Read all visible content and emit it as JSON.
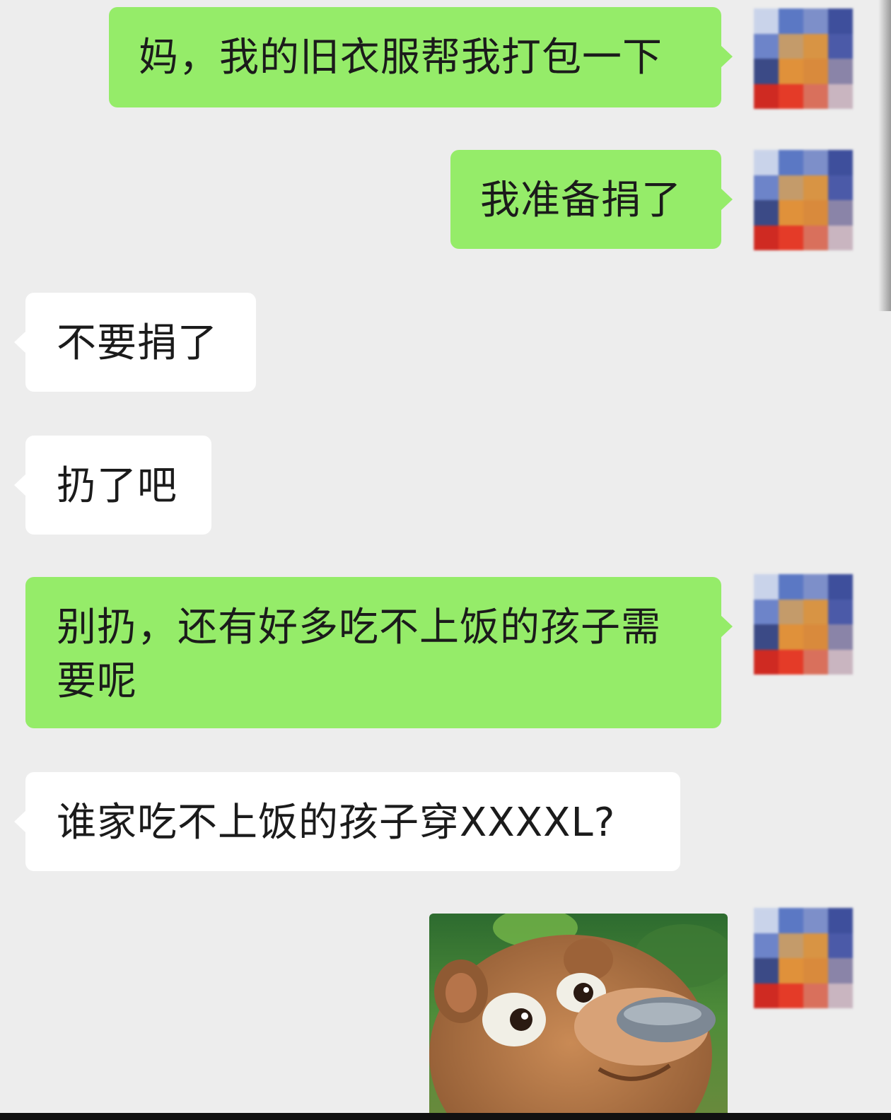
{
  "chat": {
    "messages": [
      {
        "side": "out",
        "text": "妈，我的旧衣服帮我打包一下"
      },
      {
        "side": "out",
        "text": "我准备捐了"
      },
      {
        "side": "in",
        "text": "不要捐了"
      },
      {
        "side": "in",
        "text": "扔了吧"
      },
      {
        "side": "out",
        "text": "别扔，还有好多吃不上饭的孩子需要呢"
      },
      {
        "side": "in",
        "text": "谁家吃不上饭的孩子穿XXXXL?"
      },
      {
        "side": "out",
        "type": "sticker",
        "sticker": "cartoon-bear-face"
      }
    ],
    "avatar": {
      "style": "pixelated",
      "icon": "user-avatar-icon"
    }
  },
  "colors": {
    "background": "#ededed",
    "outgoing_bubble": "#95ec69",
    "incoming_bubble": "#ffffff",
    "text": "#1b1b1b"
  }
}
